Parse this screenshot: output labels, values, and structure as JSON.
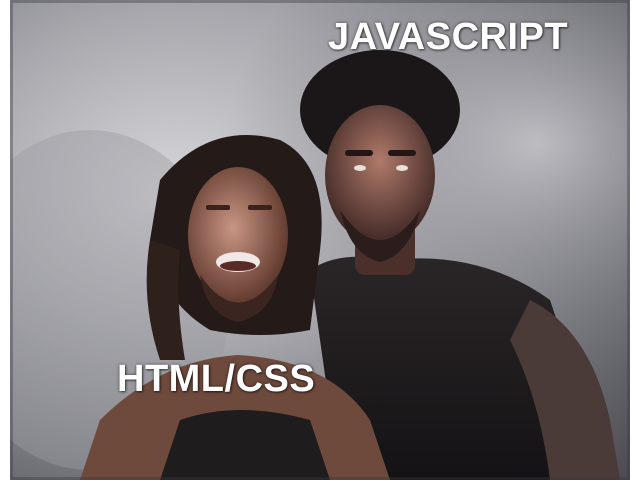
{
  "meme": {
    "top_caption": "JAVASCRIPT",
    "bottom_caption": "HTML/CSS"
  },
  "colors": {
    "caption_text": "#ffffff",
    "smoke": "#b4b4ba",
    "shadow": "#1a1a1e"
  },
  "figures": {
    "foreground": "scared-man-figure",
    "background": "looming-man-figure"
  }
}
